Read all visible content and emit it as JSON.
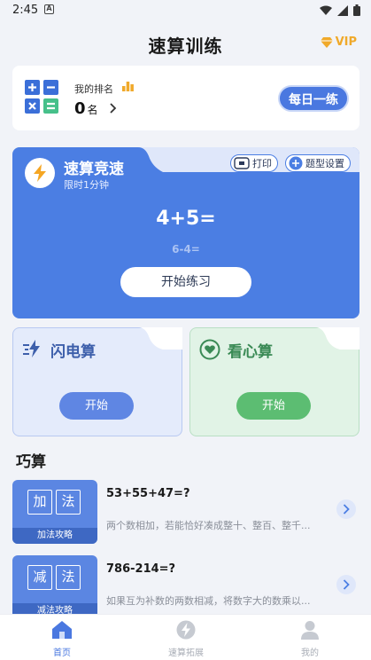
{
  "status_bar": {
    "time": "2:45",
    "notification_letter": "A"
  },
  "header": {
    "title": "速算训练",
    "vip_label": "VIP"
  },
  "rank": {
    "label": "我的排名",
    "value": "0",
    "unit": "名",
    "daily_button": "每日一练"
  },
  "speed": {
    "title": "速算竞速",
    "subtitle": "限时1分钟",
    "print_label": "打印",
    "settings_label": "题型设置",
    "equation": "4+5=",
    "next_equation": "6-4=",
    "start_button": "开始练习"
  },
  "modes": [
    {
      "title": "闪电算",
      "button": "开始"
    },
    {
      "title": "看心算",
      "button": "开始"
    }
  ],
  "tricks": {
    "title": "巧算",
    "items": [
      {
        "chars": [
          "加",
          "法"
        ],
        "caption": "加法攻略",
        "equation": "53+55+47=?",
        "description": "两个数相加，若能恰好凑成整十、整百、整千..."
      },
      {
        "chars": [
          "减",
          "法"
        ],
        "caption": "减法攻略",
        "equation": "786-214=?",
        "description": "如果互为补数的两数相减，将数字大的数乘以..."
      }
    ]
  },
  "nav": {
    "home": "首页",
    "expand": "速算拓展",
    "mine": "我的"
  },
  "colors": {
    "primary": "#4b7ee3",
    "green": "#5cbd72",
    "vip": "#f0a92a"
  }
}
